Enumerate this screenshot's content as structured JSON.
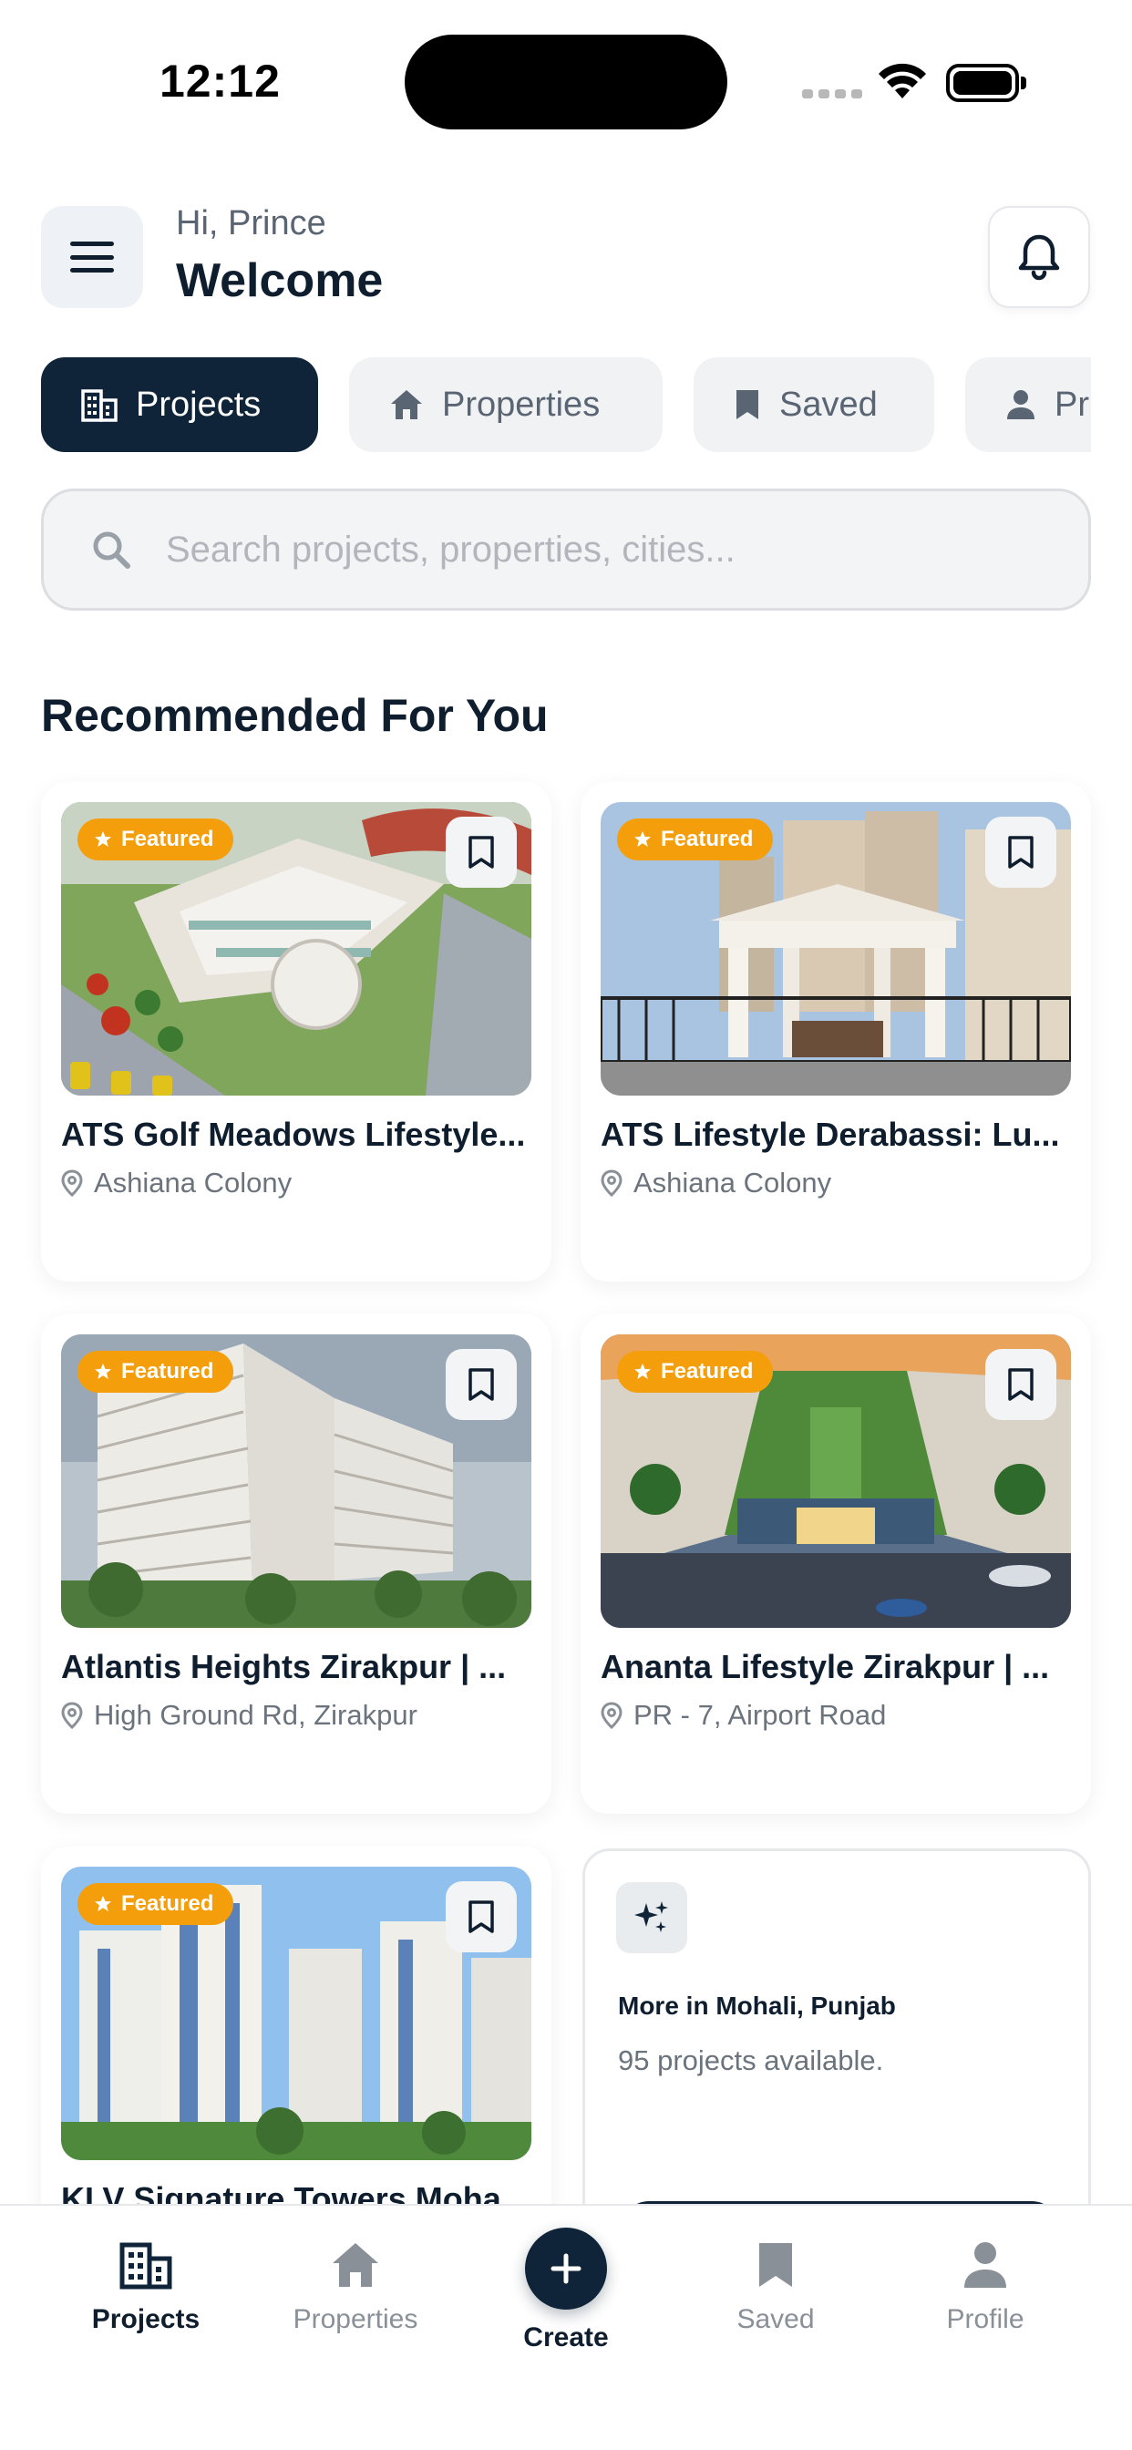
{
  "status_bar": {
    "time": "12:12"
  },
  "header": {
    "greeting": "Hi, Prince",
    "welcome": "Welcome"
  },
  "tabs": [
    {
      "label": "Projects",
      "icon": "building-icon",
      "active": true
    },
    {
      "label": "Properties",
      "icon": "home-icon",
      "active": false
    },
    {
      "label": "Saved",
      "icon": "bookmark-icon",
      "active": false
    },
    {
      "label": "Pr",
      "icon": "person-icon",
      "active": false
    }
  ],
  "search": {
    "placeholder": "Search projects, properties, cities..."
  },
  "section_title": "Recommended For You",
  "cards": [
    {
      "badge": "Featured",
      "title": "ATS Golf Meadows Lifestyle...",
      "location": "Ashiana Colony"
    },
    {
      "badge": "Featured",
      "title": "ATS Lifestyle Derabassi: Lu...",
      "location": "Ashiana Colony"
    },
    {
      "badge": "Featured",
      "title": "Atlantis Heights Zirakpur | ...",
      "location": "High Ground Rd, Zirakpur"
    },
    {
      "badge": "Featured",
      "title": "Ananta Lifestyle Zirakpur | ...",
      "location": "PR - 7, Airport Road"
    },
    {
      "badge": "Featured",
      "title": "KLV Signature Towers Moha...",
      "location": ""
    }
  ],
  "more_card": {
    "title": "More in Mohali, Punjab",
    "subtitle": "95 projects available."
  },
  "bottom_nav": {
    "projects": "Projects",
    "properties": "Properties",
    "create": "Create",
    "saved": "Saved",
    "profile": "Profile"
  },
  "colors": {
    "primary": "#0f2438",
    "featured": "#f59e0b",
    "muted": "#8a9098"
  }
}
